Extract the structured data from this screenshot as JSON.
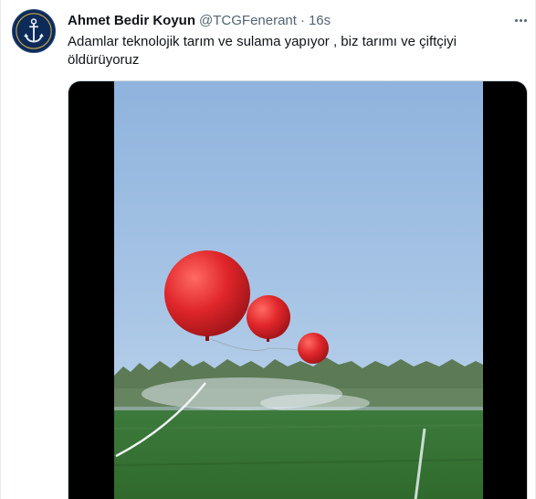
{
  "tweet": {
    "author_name": "Ahmet Bedir Koyun",
    "author_handle": "@TCGFenerant",
    "separator": "·",
    "timestamp": "16s",
    "text": "Adamlar teknolojik tarım ve sulama yapıyor , biz tarımı ve çiftçiyi öldürüyoruz",
    "avatar_icon": "anchor-icon",
    "more_icon": "more-options-icon"
  },
  "colors": {
    "avatar_bg": "#0c2b59",
    "secondary_text": "#536471",
    "balloon": "#e0262b"
  }
}
